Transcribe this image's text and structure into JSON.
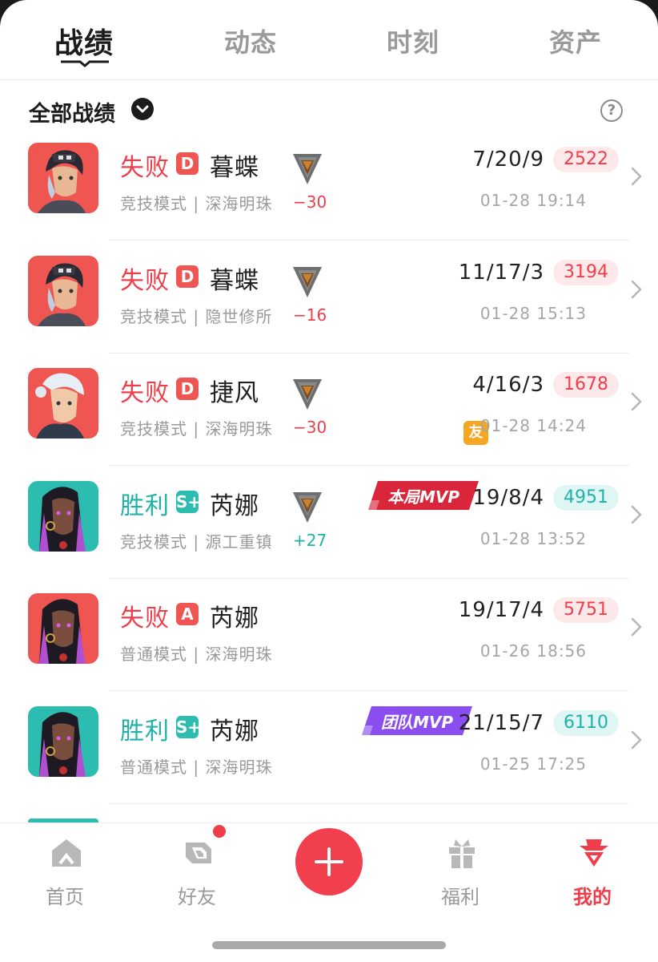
{
  "top_tabs": [
    {
      "label": "战绩",
      "active": true
    },
    {
      "label": "动态",
      "active": false
    },
    {
      "label": "时刻",
      "active": false
    },
    {
      "label": "资产",
      "active": false
    }
  ],
  "filter": {
    "label": "全部战绩",
    "help_icon": "question-circle-icon"
  },
  "colors": {
    "loss": "#ef3e4a",
    "win": "#1fb2a7",
    "badge_loss": "#ef5551",
    "badge_win": "#2cbdb0",
    "pill_loss_bg": "#fde8ea",
    "pill_win_bg": "#e0f6f4",
    "mvp_red": "#d9263a",
    "mvp_purple": "#8a4ef0",
    "friend": "#f5a623",
    "accent": "#f23f4e"
  },
  "matches": [
    {
      "result": "失败",
      "outcome": "loss",
      "rank": "D",
      "hero": "暮蝶",
      "mode_map": "竞技模式 | 深海明珠",
      "rr": "−30",
      "kda": "7/20/9",
      "score": "2522",
      "time": "01-28 19:14",
      "show_tier": true,
      "avatar": "deadlock"
    },
    {
      "result": "失败",
      "outcome": "loss",
      "rank": "D",
      "hero": "暮蝶",
      "mode_map": "竞技模式 | 隐世修所",
      "rr": "−16",
      "kda": "11/17/3",
      "score": "3194",
      "time": "01-28 15:13",
      "show_tier": true,
      "avatar": "deadlock"
    },
    {
      "result": "失败",
      "outcome": "loss",
      "rank": "D",
      "hero": "捷风",
      "mode_map": "竞技模式 | 深海明珠",
      "rr": "−30",
      "kda": "4/16/3",
      "score": "1678",
      "time": "01-28 14:24",
      "show_tier": true,
      "friend": "友",
      "avatar": "jett"
    },
    {
      "result": "胜利",
      "outcome": "win",
      "rank": "S+",
      "hero": "芮娜",
      "mode_map": "竞技模式 | 源工重镇",
      "rr": "+27",
      "kda": "19/8/4",
      "score": "4951",
      "time": "01-28 13:52",
      "show_tier": true,
      "mvp": "本局MVP",
      "avatar": "reyna"
    },
    {
      "result": "失败",
      "outcome": "loss",
      "rank": "A",
      "hero": "芮娜",
      "mode_map": "普通模式 | 深海明珠",
      "kda": "19/17/4",
      "score": "5751",
      "time": "01-26 18:56",
      "show_tier": false,
      "avatar": "reyna"
    },
    {
      "result": "胜利",
      "outcome": "win",
      "rank": "S+",
      "hero": "芮娜",
      "mode_map": "普通模式 | 深海明珠",
      "kda": "21/15/7",
      "score": "6110",
      "time": "01-25 17:25",
      "show_tier": false,
      "mvp": "团队MVP",
      "avatar": "reyna"
    }
  ],
  "bottom_nav": [
    {
      "label": "首页",
      "icon": "home-icon",
      "active": false
    },
    {
      "label": "好友",
      "icon": "friends-icon",
      "active": false,
      "dot": true
    },
    {
      "label": "",
      "icon": "plus-icon",
      "center": true
    },
    {
      "label": "福利",
      "icon": "gift-icon",
      "active": false
    },
    {
      "label": "我的",
      "icon": "profile-icon",
      "active": true
    }
  ]
}
